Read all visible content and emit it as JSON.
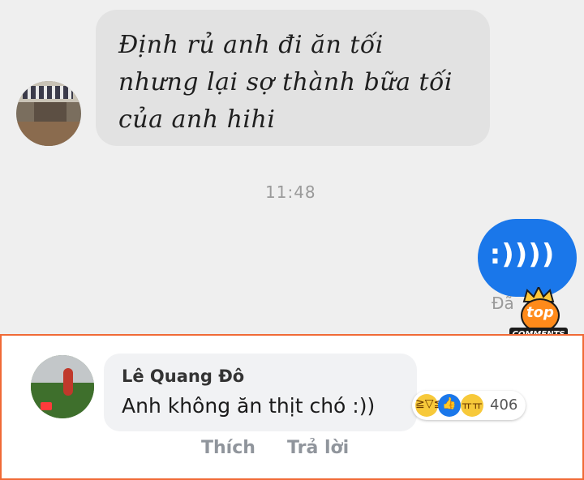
{
  "chat": {
    "incoming_lines": [
      "Định rủ anh đi ăn tối",
      "nhưng lại sợ thành bữa tối",
      "của anh hihi"
    ],
    "time": "11:48",
    "outgoing": ":))))",
    "seen_label": "Đã"
  },
  "logo": {
    "top": "top",
    "comments": "COMMENTS"
  },
  "comment": {
    "name": "Lê Quang Đô",
    "text": "Anh không ăn thịt chó :))",
    "reaction_icons": [
      "haha-icon",
      "like-icon",
      "sad-icon"
    ],
    "reaction_count": "406",
    "like_label": "Thích",
    "reply_label": "Trả lời"
  },
  "colors": {
    "messenger_blue": "#1a77ea",
    "frame_orange": "#f06a36"
  }
}
